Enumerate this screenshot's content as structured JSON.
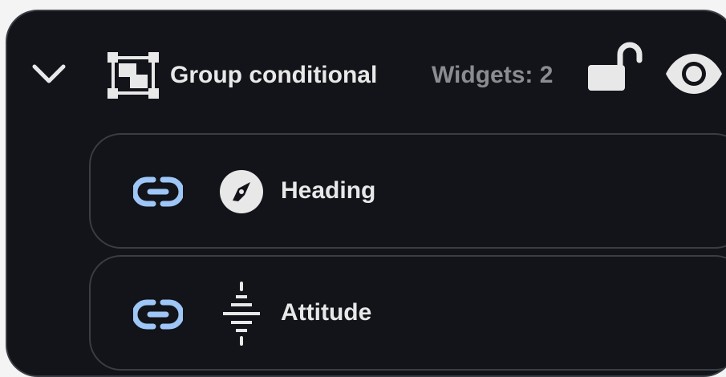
{
  "group": {
    "title": "Group conditional",
    "widget_count": "Widgets: 2",
    "expanded": true,
    "locked": false,
    "visible": true
  },
  "widgets": [
    {
      "label": "Heading",
      "icon": "compass-icon",
      "linked": true
    },
    {
      "label": "Attitude",
      "icon": "attitude-icon",
      "linked": true
    }
  ],
  "icons": {
    "chevron": "chevron-down-icon",
    "group": "group-select-icon",
    "lock": "lock-open-icon",
    "visibility": "eye-icon",
    "link": "link-icon"
  },
  "colors": {
    "background": "#121419",
    "border": "#3a3d44",
    "text": "#e8e8e8",
    "muted_text": "#8a8c90",
    "link_accent": "#9ec6f6"
  }
}
